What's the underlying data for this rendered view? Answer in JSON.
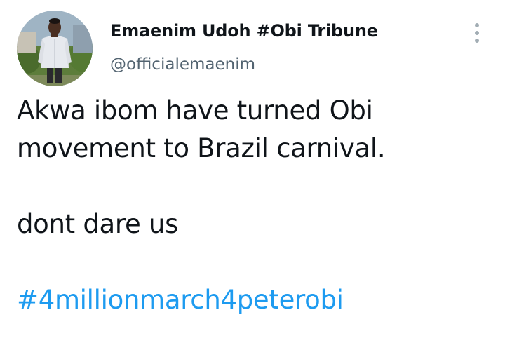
{
  "author": {
    "display_name": "Emaenim Udoh #Obi Tribune",
    "handle": "@officialemaenim",
    "avatar_icon": "profile-photo"
  },
  "menu": {
    "icon": "more-vertical-icon"
  },
  "tweet": {
    "lines": [
      "Akwa ibom have turned Obi",
      "movement to Brazil carnival."
    ],
    "line_3": "dont dare us",
    "hashtag": "#4millionmarch4peterobi"
  },
  "colors": {
    "link": "#1d9bf0",
    "secondary_text": "#536471",
    "primary_text": "#0f1419"
  }
}
